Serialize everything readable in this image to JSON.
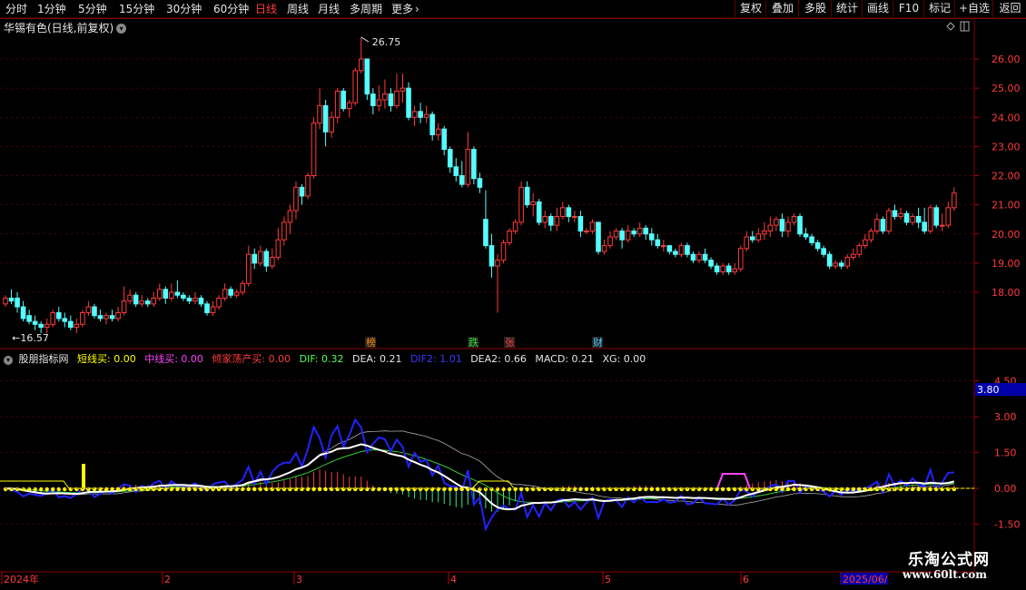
{
  "nav": {
    "periods": [
      "分时",
      "1分钟",
      "5分钟",
      "15分钟",
      "30分钟",
      "60分钟",
      "日线",
      "周线",
      "月线",
      "多周期",
      "更多"
    ],
    "active_period": "日线",
    "right_buttons": [
      "复权",
      "叠加",
      "多股",
      "统计",
      "画线",
      "F10",
      "标记",
      "+自选",
      "返回"
    ]
  },
  "stock": {
    "title": "华锡有色(日线,前复权)"
  },
  "price_axis": {
    "labels": [
      "26.00",
      "25.00",
      "24.00",
      "23.00",
      "22.00",
      "21.00",
      "20.00",
      "19.00",
      "18.00"
    ]
  },
  "annotations": {
    "high": "26.75",
    "low": "16.57",
    "markers": [
      "榜",
      "跌",
      "张",
      "财"
    ]
  },
  "indicator": {
    "name": "股朋指标网",
    "items": [
      {
        "label": "短线买: 0.00",
        "color": "#ffff00"
      },
      {
        "label": "中线买: 0.00",
        "color": "#ff44ff"
      },
      {
        "label": "倾家荡产买: 0.00",
        "color": "#ff3b3b"
      },
      {
        "label": "DIF: 0.32",
        "color": "#55ff55"
      },
      {
        "label": "DEA: 0.21",
        "color": "#e6e6e6"
      },
      {
        "label": "DIF2: 1.01",
        "color": "#3a3aff"
      },
      {
        "label": "DEA2: 0.66",
        "color": "#e6e6e6"
      },
      {
        "label": "MACD: 0.21",
        "color": "#e6e6e6"
      },
      {
        "label": "XG: 0.00",
        "color": "#e6e6e6"
      }
    ],
    "axis_labels": [
      "4.50",
      "3.00",
      "1.50",
      "0.00",
      "-1.50"
    ],
    "current_value": "3.80"
  },
  "time_axis": {
    "labels": [
      "2024年",
      "2",
      "3",
      "4",
      "5",
      "6",
      "2025/06/"
    ]
  },
  "watermark": {
    "line1": "乐淘公式网",
    "line2": "www.60lt.com"
  },
  "colors": {
    "up": "#ff3b3b",
    "down": "#54ffff",
    "border": "#8b0000",
    "grid": "#6a0000"
  },
  "chart_data": {
    "type": "candlestick",
    "candles": [
      [
        17.6,
        17.8,
        17.5,
        17.9
      ],
      [
        17.8,
        17.7,
        17.6,
        18.1
      ],
      [
        17.8,
        17.5,
        17.3,
        18.0
      ],
      [
        17.5,
        17.1,
        17.0,
        17.7
      ],
      [
        17.2,
        17.0,
        16.9,
        17.4
      ],
      [
        17.0,
        16.9,
        16.7,
        17.2
      ],
      [
        16.9,
        16.8,
        16.6,
        17.0
      ],
      [
        16.8,
        16.9,
        16.6,
        17.1
      ],
      [
        16.9,
        17.3,
        16.8,
        17.4
      ],
      [
        17.3,
        17.1,
        17.0,
        17.5
      ],
      [
        17.1,
        17.0,
        16.8,
        17.3
      ],
      [
        17.0,
        16.8,
        16.7,
        17.2
      ],
      [
        16.8,
        16.9,
        16.6,
        17.1
      ],
      [
        16.9,
        17.3,
        16.8,
        17.4
      ],
      [
        17.3,
        17.5,
        17.2,
        17.7
      ],
      [
        17.5,
        17.2,
        17.1,
        17.6
      ],
      [
        17.2,
        17.1,
        17.0,
        17.4
      ],
      [
        17.1,
        17.2,
        16.9,
        17.3
      ],
      [
        17.2,
        17.1,
        17.0,
        17.4
      ],
      [
        17.1,
        17.3,
        17.0,
        17.5
      ],
      [
        17.3,
        17.7,
        17.2,
        18.2
      ],
      [
        17.7,
        17.9,
        17.6,
        18.1
      ],
      [
        17.9,
        17.6,
        17.5,
        18.0
      ],
      [
        17.6,
        17.7,
        17.5,
        17.9
      ],
      [
        17.7,
        17.6,
        17.5,
        17.8
      ],
      [
        17.6,
        17.8,
        17.5,
        18.0
      ],
      [
        17.8,
        18.1,
        17.7,
        18.3
      ],
      [
        18.1,
        17.8,
        17.6,
        18.2
      ],
      [
        17.8,
        18.0,
        17.7,
        18.3
      ],
      [
        18.0,
        17.9,
        17.8,
        18.4
      ],
      [
        17.9,
        17.8,
        17.7,
        18.0
      ],
      [
        17.8,
        17.7,
        17.6,
        17.9
      ],
      [
        17.7,
        17.8,
        17.6,
        18.0
      ],
      [
        17.8,
        17.6,
        17.5,
        17.9
      ],
      [
        17.6,
        17.3,
        17.2,
        17.7
      ],
      [
        17.3,
        17.5,
        17.2,
        17.7
      ],
      [
        17.5,
        17.8,
        17.4,
        17.9
      ],
      [
        17.8,
        18.1,
        17.7,
        18.3
      ],
      [
        18.1,
        17.9,
        17.8,
        18.2
      ],
      [
        17.9,
        18.0,
        17.8,
        18.1
      ],
      [
        18.0,
        18.3,
        17.9,
        18.4
      ],
      [
        18.3,
        19.3,
        18.2,
        19.6
      ],
      [
        19.3,
        19.0,
        18.8,
        19.5
      ],
      [
        19.0,
        19.4,
        18.9,
        19.6
      ],
      [
        19.4,
        18.9,
        18.7,
        19.5
      ],
      [
        18.9,
        19.2,
        18.8,
        19.5
      ],
      [
        19.2,
        19.8,
        19.1,
        20.2
      ],
      [
        19.8,
        20.4,
        19.6,
        20.6
      ],
      [
        20.4,
        20.8,
        20.0,
        21.0
      ],
      [
        20.8,
        21.6,
        20.5,
        21.8
      ],
      [
        21.6,
        21.3,
        21.0,
        21.7
      ],
      [
        21.3,
        22.0,
        21.2,
        22.1
      ],
      [
        22.0,
        23.8,
        21.9,
        24.0
      ],
      [
        23.8,
        24.4,
        23.6,
        25.0
      ],
      [
        24.4,
        23.5,
        23.0,
        24.6
      ],
      [
        23.5,
        24.0,
        23.3,
        24.2
      ],
      [
        24.0,
        24.9,
        23.8,
        25.0
      ],
      [
        24.9,
        24.3,
        24.2,
        25.0
      ],
      [
        24.3,
        24.5,
        24.0,
        24.6
      ],
      [
        24.5,
        25.6,
        24.4,
        25.7
      ],
      [
        25.6,
        26.0,
        25.5,
        26.75
      ],
      [
        26.0,
        24.8,
        24.6,
        26.0
      ],
      [
        24.8,
        24.4,
        24.1,
        25.0
      ],
      [
        24.4,
        24.6,
        24.2,
        25.1
      ],
      [
        24.6,
        24.8,
        24.3,
        25.3
      ],
      [
        24.8,
        24.4,
        24.2,
        25.0
      ],
      [
        24.4,
        24.9,
        24.3,
        25.5
      ],
      [
        24.9,
        25.0,
        24.5,
        25.5
      ],
      [
        25.0,
        24.0,
        23.9,
        25.2
      ],
      [
        24.0,
        24.2,
        23.7,
        24.4
      ],
      [
        24.2,
        24.0,
        23.8,
        24.5
      ],
      [
        24.0,
        24.1,
        23.8,
        24.4
      ],
      [
        24.1,
        23.4,
        23.2,
        24.2
      ],
      [
        23.4,
        23.6,
        23.2,
        23.8
      ],
      [
        23.6,
        22.9,
        22.7,
        23.7
      ],
      [
        22.9,
        22.3,
        22.1,
        23.0
      ],
      [
        22.3,
        22.0,
        21.8,
        22.6
      ],
      [
        22.0,
        21.7,
        21.6,
        22.5
      ],
      [
        21.7,
        22.9,
        21.6,
        23.5
      ],
      [
        22.9,
        21.9,
        21.7,
        23.0
      ],
      [
        21.9,
        21.6,
        21.4,
        22.1
      ],
      [
        20.5,
        19.6,
        19.5,
        21.5
      ],
      [
        19.6,
        18.9,
        18.5,
        20.0
      ],
      [
        18.9,
        19.1,
        17.3,
        19.3
      ],
      [
        19.1,
        19.7,
        19.0,
        19.8
      ],
      [
        19.7,
        20.1,
        19.6,
        20.2
      ],
      [
        20.1,
        20.4,
        20.0,
        20.5
      ],
      [
        20.4,
        21.6,
        20.3,
        21.8
      ],
      [
        21.6,
        21.0,
        20.9,
        21.8
      ],
      [
        21.0,
        21.1,
        20.6,
        21.4
      ],
      [
        21.1,
        20.4,
        20.3,
        21.2
      ],
      [
        20.4,
        20.6,
        20.2,
        20.8
      ],
      [
        20.6,
        20.3,
        20.1,
        20.7
      ],
      [
        20.3,
        20.6,
        20.1,
        20.9
      ],
      [
        20.6,
        20.9,
        20.5,
        21.1
      ],
      [
        20.9,
        20.6,
        20.4,
        21.0
      ],
      [
        20.6,
        20.6,
        20.4,
        20.8
      ],
      [
        20.6,
        20.1,
        19.9,
        20.8
      ],
      [
        20.1,
        20.1,
        20.0,
        20.2
      ],
      [
        20.1,
        20.4,
        20.0,
        20.5
      ],
      [
        20.4,
        19.4,
        19.3,
        20.2
      ],
      [
        19.4,
        19.6,
        19.3,
        19.8
      ],
      [
        19.6,
        19.9,
        19.5,
        20.1
      ],
      [
        19.9,
        20.1,
        19.8,
        20.2
      ],
      [
        20.1,
        19.8,
        19.5,
        20.2
      ],
      [
        19.8,
        20.1,
        19.7,
        20.3
      ],
      [
        20.1,
        20.0,
        19.9,
        20.2
      ],
      [
        20.0,
        20.2,
        19.9,
        20.4
      ],
      [
        20.2,
        20.0,
        19.8,
        20.3
      ],
      [
        20.0,
        19.8,
        19.6,
        20.2
      ],
      [
        19.8,
        19.6,
        19.5,
        20.0
      ],
      [
        19.6,
        19.6,
        19.4,
        19.8
      ],
      [
        19.6,
        19.4,
        19.3,
        19.6
      ],
      [
        19.4,
        19.3,
        19.2,
        19.5
      ],
      [
        19.3,
        19.6,
        19.2,
        19.7
      ],
      [
        19.6,
        19.3,
        19.2,
        19.7
      ],
      [
        19.3,
        19.1,
        19.0,
        19.4
      ],
      [
        19.1,
        19.3,
        19.0,
        19.4
      ],
      [
        19.3,
        19.1,
        19.0,
        19.5
      ],
      [
        19.1,
        18.9,
        18.8,
        19.2
      ],
      [
        18.9,
        18.7,
        18.6,
        19.0
      ],
      [
        18.7,
        18.9,
        18.6,
        19.0
      ],
      [
        18.9,
        18.7,
        18.6,
        19.0
      ],
      [
        18.7,
        18.8,
        18.6,
        19.0
      ],
      [
        18.8,
        19.5,
        18.7,
        19.6
      ],
      [
        19.5,
        19.9,
        19.4,
        20.1
      ],
      [
        19.9,
        19.8,
        19.7,
        20.1
      ],
      [
        19.8,
        20.0,
        19.7,
        20.2
      ],
      [
        20.0,
        20.1,
        19.8,
        20.4
      ],
      [
        20.1,
        20.3,
        19.9,
        20.6
      ],
      [
        20.3,
        20.5,
        20.1,
        20.6
      ],
      [
        20.5,
        20.1,
        19.9,
        20.7
      ],
      [
        20.1,
        20.4,
        19.9,
        20.6
      ],
      [
        20.4,
        20.6,
        20.3,
        20.7
      ],
      [
        20.6,
        20.0,
        19.9,
        20.7
      ],
      [
        20.0,
        19.9,
        19.8,
        20.2
      ],
      [
        19.9,
        19.7,
        19.6,
        20.0
      ],
      [
        19.7,
        19.5,
        19.4,
        19.8
      ],
      [
        19.5,
        19.3,
        19.2,
        19.6
      ],
      [
        19.3,
        18.9,
        18.8,
        19.4
      ],
      [
        18.9,
        19.0,
        18.8,
        19.1
      ],
      [
        19.0,
        18.9,
        18.8,
        19.1
      ],
      [
        18.9,
        19.2,
        18.8,
        19.3
      ],
      [
        19.2,
        19.3,
        19.1,
        19.5
      ],
      [
        19.3,
        19.6,
        19.2,
        19.7
      ],
      [
        19.6,
        19.8,
        19.5,
        20.0
      ],
      [
        19.8,
        20.1,
        19.7,
        20.2
      ],
      [
        20.1,
        20.5,
        20.0,
        20.7
      ],
      [
        20.5,
        20.1,
        20.0,
        20.6
      ],
      [
        20.1,
        20.8,
        20.0,
        20.9
      ],
      [
        20.8,
        20.6,
        20.5,
        21.0
      ],
      [
        20.6,
        20.7,
        20.5,
        20.9
      ],
      [
        20.7,
        20.4,
        20.3,
        20.8
      ],
      [
        20.4,
        20.6,
        20.3,
        20.7
      ],
      [
        20.6,
        20.4,
        20.2,
        20.9
      ],
      [
        20.4,
        20.1,
        20.0,
        20.9
      ],
      [
        20.1,
        20.9,
        20.0,
        21.0
      ],
      [
        20.9,
        20.3,
        20.2,
        21.0
      ],
      [
        20.3,
        20.3,
        20.1,
        20.7
      ],
      [
        20.3,
        20.9,
        20.2,
        21.1
      ],
      [
        20.9,
        21.4,
        20.8,
        21.6
      ]
    ],
    "ylim": [
      17.0,
      27.0
    ],
    "price_axis_values": [
      26,
      25,
      24,
      23,
      22,
      21,
      20,
      19,
      18
    ]
  }
}
